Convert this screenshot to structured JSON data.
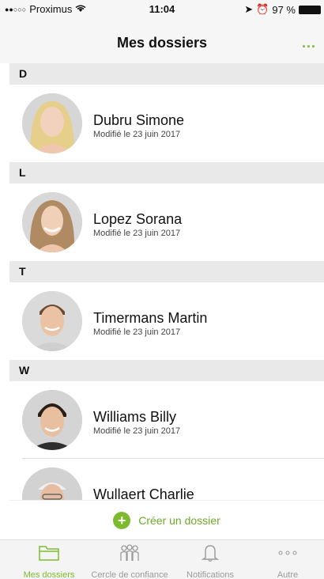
{
  "status_bar": {
    "carrier": "Proximus",
    "time": "11:04",
    "battery": "97 %"
  },
  "nav": {
    "title": "Mes dossiers",
    "more_label": "..."
  },
  "sections": [
    {
      "letter": "D",
      "contacts": [
        {
          "name": "Dubru Simone",
          "modified": "Modifié le 23 juin 2017"
        }
      ]
    },
    {
      "letter": "L",
      "contacts": [
        {
          "name": "Lopez Sorana",
          "modified": "Modifié le 23 juin 2017"
        }
      ]
    },
    {
      "letter": "T",
      "contacts": [
        {
          "name": "Timermans Martin",
          "modified": "Modifié le 23 juin 2017"
        }
      ]
    },
    {
      "letter": "W",
      "contacts": [
        {
          "name": "Williams Billy",
          "modified": "Modifié le 23 juin 2017"
        },
        {
          "name": "Wullaert Charlie",
          "modified": ""
        }
      ]
    }
  ],
  "create_button": {
    "label": "Créer un dossier"
  },
  "tabs": [
    {
      "label": "Mes dossiers",
      "icon": "folder-icon",
      "active": true
    },
    {
      "label": "Cercle de confiance",
      "icon": "people-icon",
      "active": false
    },
    {
      "label": "Notifications",
      "icon": "bell-icon",
      "active": false
    },
    {
      "label": "Autre",
      "icon": "more-dots-icon",
      "active": false
    }
  ],
  "colors": {
    "accent": "#7dbb2e",
    "section_bg": "#e9e9e9",
    "tab_inactive": "#9a9a9a"
  }
}
